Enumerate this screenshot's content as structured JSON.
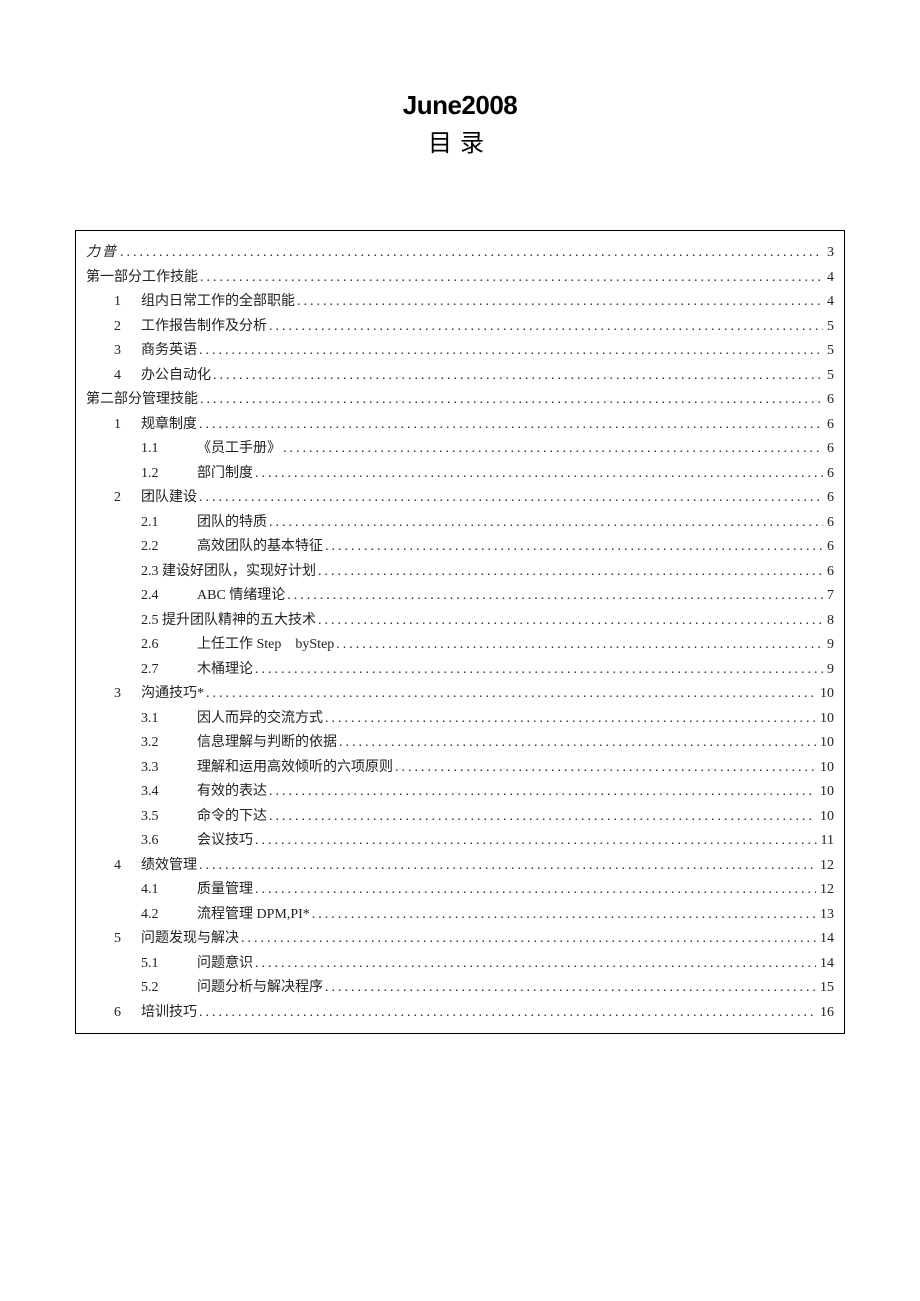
{
  "header": {
    "title": "June2008",
    "subtitle": "目录"
  },
  "toc": [
    {
      "level": 0,
      "cls": "first-row",
      "num": "",
      "label": "力普",
      "page": "3"
    },
    {
      "level": 0,
      "num": "",
      "label": "第一部分工作技能",
      "page": "4"
    },
    {
      "level": 1,
      "num": "1",
      "label": "组内日常工作的全部职能",
      "page": "4"
    },
    {
      "level": 1,
      "num": "2",
      "label": "工作报告制作及分析",
      "page": "5"
    },
    {
      "level": 1,
      "num": "3",
      "label": "商务英语",
      "page": "5"
    },
    {
      "level": 1,
      "num": "4",
      "label": "办公自动化",
      "page": "5"
    },
    {
      "level": 0,
      "num": "",
      "label": "第二部分管理技能",
      "page": "6"
    },
    {
      "level": 1,
      "num": "1",
      "label": "规章制度",
      "page": "6"
    },
    {
      "level": 2,
      "num": "1.1",
      "label": "《员工手册》",
      "page": "6"
    },
    {
      "level": 2,
      "num": "1.2",
      "label": "部门制度",
      "page": "6"
    },
    {
      "level": 1,
      "num": "2",
      "label": "团队建设",
      "page": "6"
    },
    {
      "level": 2,
      "num": "2.1",
      "label": "团队的特质",
      "page": "6"
    },
    {
      "level": 2,
      "num": "2.2",
      "label": "高效团队的基本特征",
      "page": "6"
    },
    {
      "level": 2,
      "num": "",
      "cls": "lvl2-noindent",
      "label": "2.3 建设好团队，实现好计划 ",
      "page": "6"
    },
    {
      "level": 2,
      "num": "2.4",
      "label": "ABC 情绪理论",
      "page": "7"
    },
    {
      "level": 2,
      "num": "",
      "cls": "lvl2-noindent",
      "label": "2.5 提升团队精神的五大技术 ",
      "page": "8"
    },
    {
      "level": 2,
      "num": "2.6",
      "label": "上任工作 Step byStep",
      "page": "9"
    },
    {
      "level": 2,
      "num": "2.7",
      "label": "木桶理论",
      "page": "9"
    },
    {
      "level": 1,
      "num": "3",
      "label": "沟通技巧*",
      "page": "10"
    },
    {
      "level": 2,
      "num": "3.1",
      "label": "因人而异的交流方式",
      "page": "10"
    },
    {
      "level": 2,
      "num": "3.2",
      "label": "信息理解与判断的依据",
      "page": "10"
    },
    {
      "level": 2,
      "num": "3.3",
      "label": "理解和运用高效倾听的六项原则",
      "page": "10"
    },
    {
      "level": 2,
      "num": "3.4",
      "label": "有效的表达",
      "page": "10"
    },
    {
      "level": 2,
      "num": "3.5",
      "label": "命令的下达",
      "page": "10"
    },
    {
      "level": 2,
      "num": "3.6",
      "label": "会议技巧",
      "page": "11"
    },
    {
      "level": 1,
      "num": "4",
      "label": "绩效管理",
      "page": "12"
    },
    {
      "level": 2,
      "num": "4.1",
      "label": "质量管理",
      "page": "12"
    },
    {
      "level": 2,
      "num": "4.2",
      "label": "流程管理 DPM,PI*",
      "page": "13"
    },
    {
      "level": 1,
      "num": "5",
      "label": "问题发现与解决",
      "page": "14"
    },
    {
      "level": 2,
      "num": "5.1",
      "label": "问题意识",
      "page": "14"
    },
    {
      "level": 2,
      "num": "5.2",
      "label": "问题分析与解决程序",
      "page": "15"
    },
    {
      "level": 1,
      "num": "6",
      "label": "培训技巧",
      "page": "16"
    }
  ]
}
